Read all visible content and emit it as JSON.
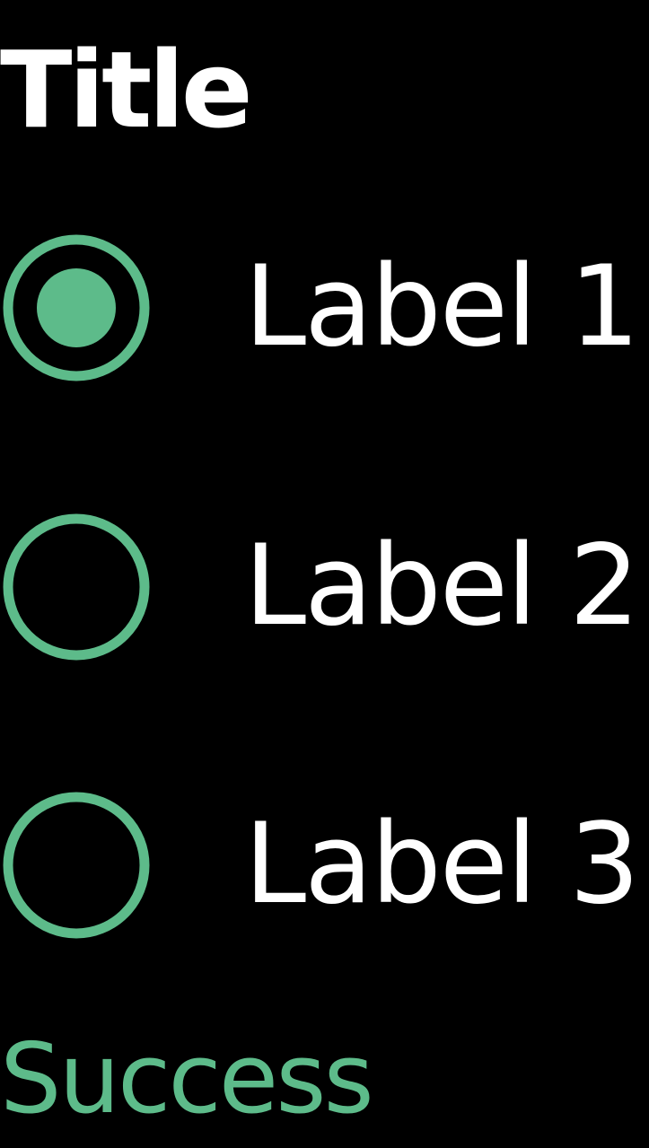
{
  "title": "Title",
  "accent_color": "#5dbb8a",
  "radio_group": {
    "options": [
      {
        "label": "Label 1",
        "selected": true,
        "icon": "radio-selected-icon"
      },
      {
        "label": "Label 2",
        "selected": false,
        "icon": "radio-unselected-icon"
      },
      {
        "label": "Label 3",
        "selected": false,
        "icon": "radio-unselected-icon"
      }
    ]
  },
  "status": {
    "text": "Success",
    "color": "#5dbb8a"
  }
}
